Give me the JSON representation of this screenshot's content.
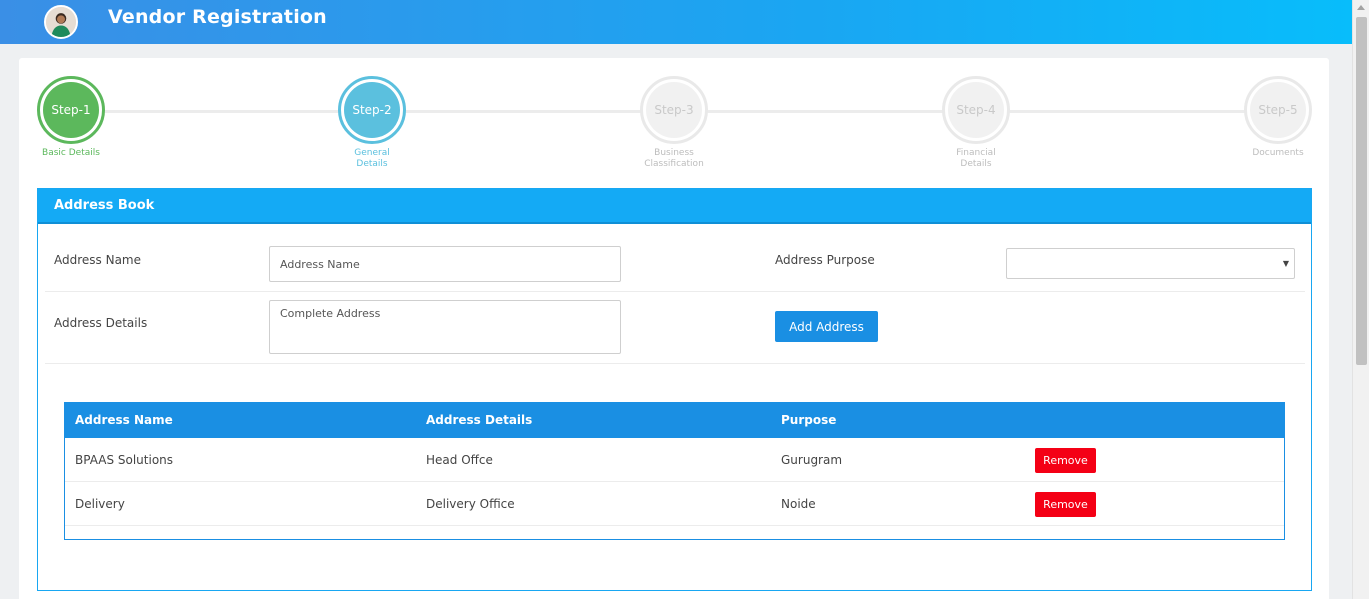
{
  "header": {
    "title": "Vendor Registration",
    "avatar_icon": "user-avatar-icon"
  },
  "stepper": {
    "steps": [
      {
        "circle": "Step-1",
        "label_line1": "Basic Details",
        "label_line2": "",
        "state": "done"
      },
      {
        "circle": "Step-2",
        "label_line1": "General",
        "label_line2": "Details",
        "state": "active"
      },
      {
        "circle": "Step-3",
        "label_line1": "Business",
        "label_line2": "Classification",
        "state": "pending"
      },
      {
        "circle": "Step-4",
        "label_line1": "Financial",
        "label_line2": "Details",
        "state": "pending"
      },
      {
        "circle": "Step-5",
        "label_line1": "Documents",
        "label_line2": "",
        "state": "pending"
      }
    ]
  },
  "address_book": {
    "title": "Address Book",
    "address_name_label": "Address Name",
    "address_name_placeholder": "Address Name",
    "address_purpose_label": "Address Purpose",
    "address_purpose_value": "",
    "address_details_label": "Address Details",
    "address_details_placeholder": "Complete Address",
    "add_button": "Add Address"
  },
  "table": {
    "headers": [
      "Address Name",
      "Address Details",
      "Purpose"
    ],
    "rows": [
      {
        "name": "BPAAS Solutions",
        "details": "Head Offce",
        "purpose": "Gurugram",
        "action": "Remove"
      },
      {
        "name": "Delivery",
        "details": "Delivery Office",
        "purpose": "Noide",
        "action": "Remove"
      }
    ]
  },
  "colors": {
    "header_gradient_start": "#3a8fe6",
    "header_gradient_end": "#08bdfb",
    "step_done": "#5cb85c",
    "step_active": "#5bc0de",
    "panel_header": "#14aaf5",
    "button_primary": "#1a8fe3",
    "button_danger": "#f40015"
  }
}
